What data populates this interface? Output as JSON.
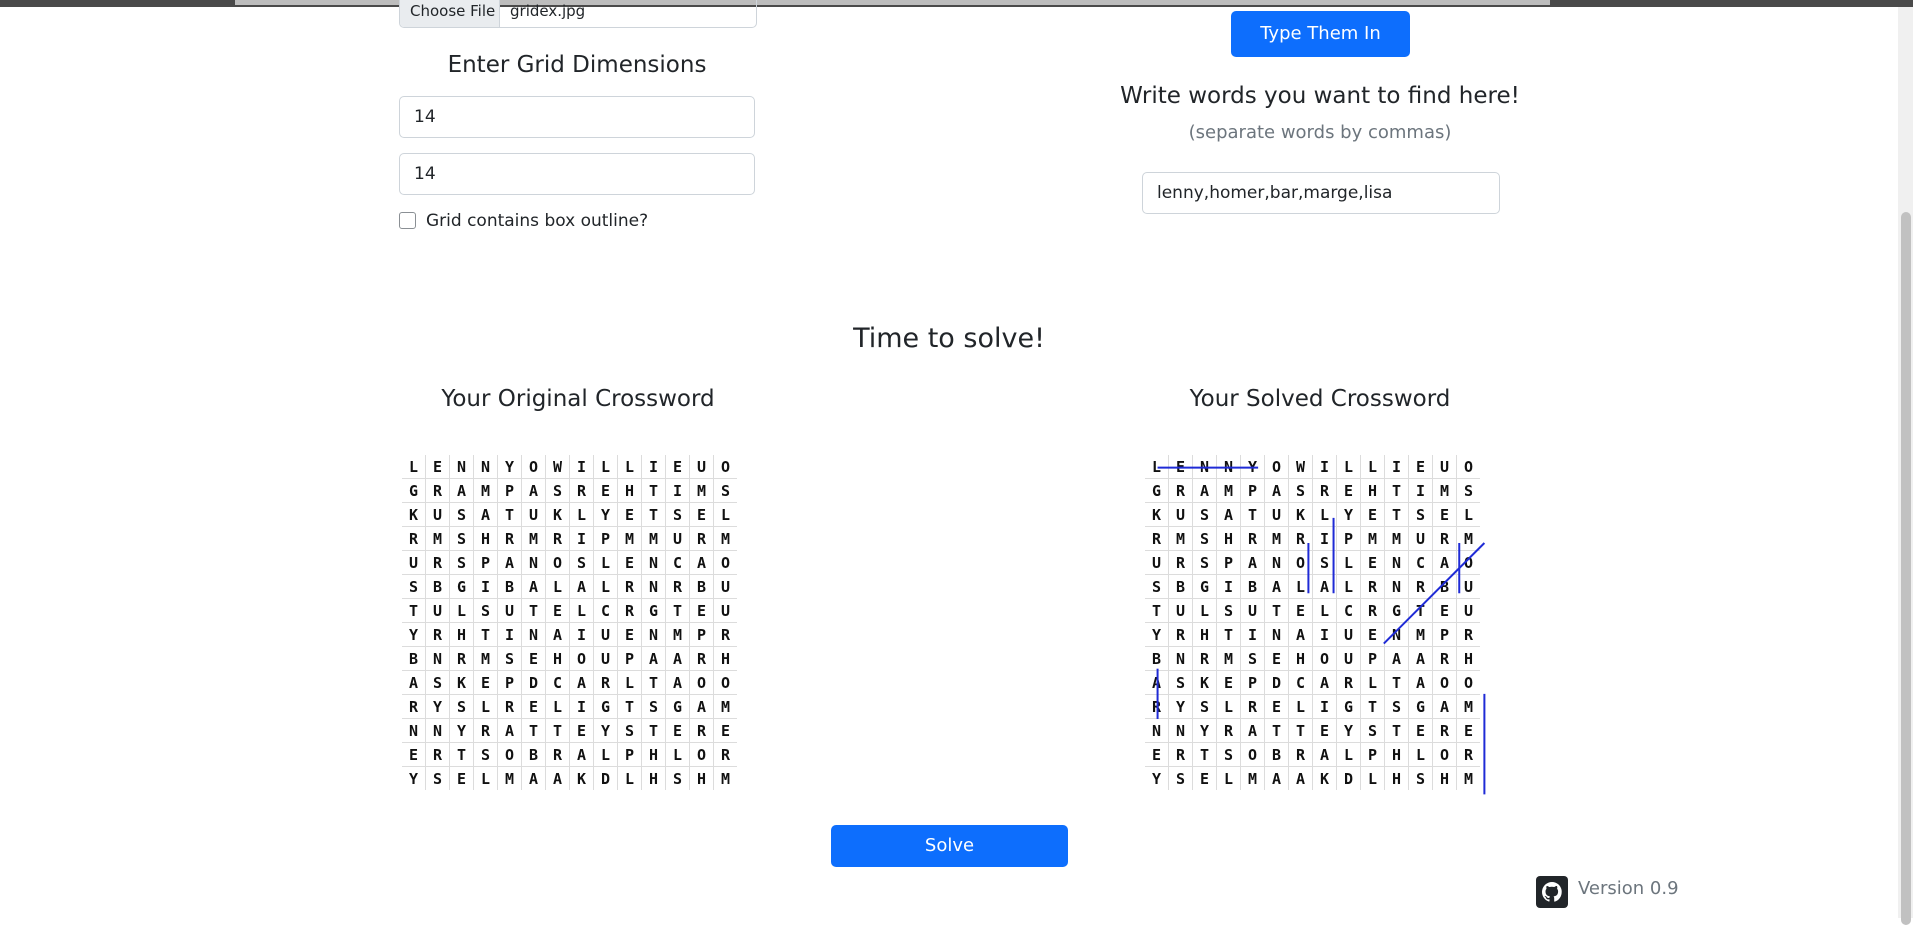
{
  "file_input": {
    "button_label": "Choose File",
    "file_name": "gridex.jpg"
  },
  "dimensions": {
    "title": "Enter Grid Dimensions",
    "rows_value": "14",
    "cols_value": "14",
    "outline_checkbox_label": "Grid contains box outline?",
    "outline_checked": false
  },
  "words": {
    "type_button_label": "Type Them In",
    "title": "Write words you want to find here!",
    "subtitle": "(separate words by commas)",
    "input_value": "lenny,homer,bar,marge,lisa"
  },
  "solve_section": {
    "title": "Time to solve!",
    "original_title": "Your Original Crossword",
    "solved_title": "Your Solved Crossword",
    "solve_button_label": "Solve"
  },
  "grid": {
    "rows": [
      "LENNYOWILLIEUO",
      "GRAMPASREHTIMS",
      "KUSATUKLYETSEL",
      "RMSHRMRIPMMURM",
      "URSPANOSLENCAO",
      "SBGIBALALRNRBU",
      "TULSUTELCRGTEU",
      "YRHTINAIUENMPR",
      "BNRMSEHOUPAARH",
      "ASKEPDCARLTAOO",
      "RYSLRELIGTSGAM",
      "NNYRATTEYSTERE",
      "ERTSOBRALPHLOR",
      "YSELMAAKDLHSHM"
    ],
    "solutions": [
      {
        "word": "lenny",
        "start": [
          0,
          0
        ],
        "end": [
          0,
          4
        ]
      },
      {
        "word": "homer",
        "start": [
          9,
          13
        ],
        "end": [
          13,
          13
        ]
      },
      {
        "word": "bar",
        "start": [
          3,
          6
        ],
        "end": [
          5,
          6
        ]
      },
      {
        "word": "marge",
        "start": [
          3,
          13
        ],
        "end": [
          7,
          9
        ]
      },
      {
        "word": "lisa",
        "start": [
          2,
          7
        ],
        "end": [
          5,
          7
        ]
      },
      {
        "word": "",
        "start": [
          3,
          12
        ],
        "end": [
          5,
          12
        ]
      },
      {
        "word": "",
        "start": [
          8,
          0
        ],
        "end": [
          10,
          0
        ]
      }
    ],
    "line_color": "#1f2bd6"
  },
  "footer": {
    "version": "Version 0.9",
    "icon": "github-icon"
  }
}
